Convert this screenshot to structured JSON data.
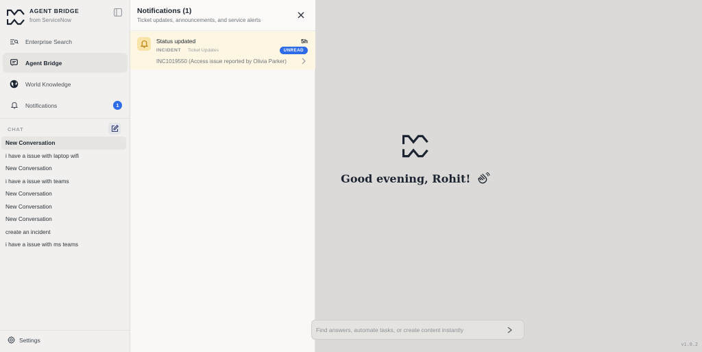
{
  "app": {
    "name": "AGENT BRIDGE",
    "subtitle": "from ServiceNow"
  },
  "sidebar": {
    "nav": [
      {
        "label": "Enterprise Search",
        "icon": "search-list-icon",
        "active": false
      },
      {
        "label": "Agent Bridge",
        "icon": "chat-bubble-icon",
        "active": true
      },
      {
        "label": "World Knowledge",
        "icon": "globe-icon",
        "active": false
      },
      {
        "label": "Notifications",
        "icon": "bell-icon",
        "active": false,
        "badge": "1"
      }
    ],
    "chat_label": "CHAT",
    "chats": [
      {
        "label": "New Conversation",
        "active": true
      },
      {
        "label": "i have a issue with laptop wifi"
      },
      {
        "label": "New Conversation"
      },
      {
        "label": "i have a issue with teams"
      },
      {
        "label": "New Conversation"
      },
      {
        "label": "New Conversation"
      },
      {
        "label": "New Conversation"
      },
      {
        "label": "create an incident"
      },
      {
        "label": "i have a issue with ms teams"
      }
    ],
    "settings_label": "Settings"
  },
  "notifications": {
    "title": "Notifications (1)",
    "subtitle": "Ticket updates, announcements, and service alerts",
    "items": [
      {
        "title": "Status updated",
        "time": "5h",
        "type": "INCIDENT",
        "category": "Ticket Updates",
        "status": "UNREAD",
        "body": "INC1019550 (Access issue reported by Olivia Parker)"
      }
    ]
  },
  "main": {
    "greeting": "Good evening, Rohit!",
    "search_placeholder": "Find answers, automate tasks, or create content instantly",
    "version": "v1.0.2"
  },
  "colors": {
    "accent": "#2e6be6",
    "notification_highlight": "#fdf6e2",
    "background": "#dcdad8",
    "sidebar": "#f1f0ee"
  }
}
